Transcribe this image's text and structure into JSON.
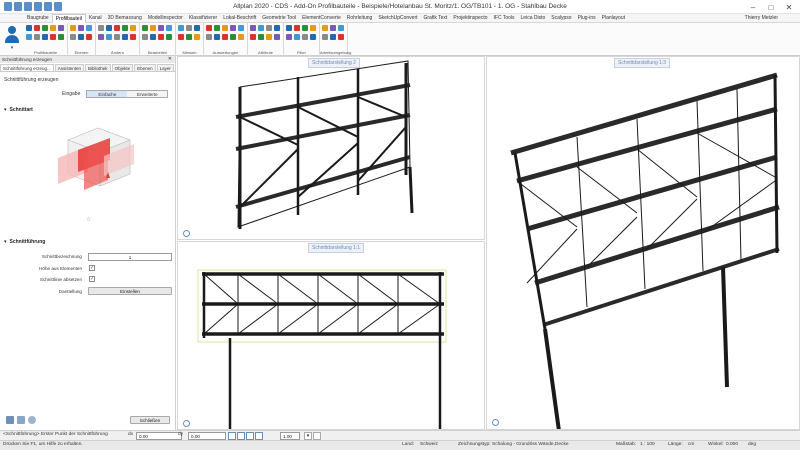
{
  "app": {
    "title": "Allplan 2020 - CDS - Add-On Profilbauteile - Beispiele/Hotelanbau St. Moritz/1. OG/TB101 - 1. OG - Stahlbau Decke",
    "user": "Thierry Metzler"
  },
  "tabs": [
    "Baugrube",
    "Profilbauteil",
    "Kanal",
    "3D Bemassung",
    "Modellinspector",
    "Klassifizierer",
    "Lokal-Beschrift",
    "Geometrie Tool",
    "ElementConverte",
    "Rohrleitung",
    "SketchUpConvert",
    "Grafik Text",
    "Projektinspecto",
    "IFC Tools",
    "Leica Disto",
    "Scalypso",
    "Plug-ins",
    "Planlayout"
  ],
  "active_tab_index": 1,
  "ribbon_groups": [
    "Profilbauteile",
    "Ebenen",
    "Ändern",
    "Bearbeiten",
    "Messen",
    "Auswertungen",
    "Attribute",
    "Filter",
    "Arbeitsumgebung"
  ],
  "sidebar": {
    "title": "Schnittführung erzeugen",
    "tabs": [
      "Schnittführung erzeug...",
      "Assistenten",
      "Bibliothek",
      "Objekte",
      "Ebenen",
      "Layer"
    ],
    "heading": "Schnittführung erzeugen",
    "eingabe_label": "Eingabe",
    "eingabe_options": [
      "Einfache",
      "Erweiterte"
    ],
    "section1": "Schnittart",
    "section2": "Schnittführung",
    "fields": {
      "bez_label": "Schnittbezeichnung",
      "bez_value": "1",
      "hoehe_label": "Höhe aus Elementen",
      "hoehe_checked": "✓",
      "absetzen_label": "Schnittlinie absetzen",
      "absetzen_checked": "✓",
      "darstellung_label": "Darstellung",
      "darstellung_button": "Einstellen"
    },
    "close_button": "Schließen"
  },
  "viewports": {
    "v1_title": "Schnittdarstellung 2",
    "v2_title": "Schnittdarstellung 1:3",
    "v3_title": "Schnittdarstellung 1:1"
  },
  "statusbar": {
    "prompt": "<Schnittführung> Erster Punkt der Schnittführung",
    "dx_label": "dx",
    "dx_value": "0.00",
    "dy_label": "dy",
    "dy_value": "0.00",
    "scale_value": "1.00"
  },
  "footer": {
    "help": "Drücken Sie F1, um Hilfe zu erhalten.",
    "land_label": "Land:",
    "land_value": "Schweiz",
    "zeichnungstyp_label": "Zeichnungstyp:",
    "zeichnungstyp_value": "Schalung - Grundriss Wände,Decke",
    "massstab_label": "Maßstab:",
    "massstab_value": "1 : 100",
    "laenge_label": "Länge:",
    "laenge_value": "cm",
    "winkel_label": "Winkel:",
    "winkel_value": "0.000",
    "grad_label": "deg"
  }
}
